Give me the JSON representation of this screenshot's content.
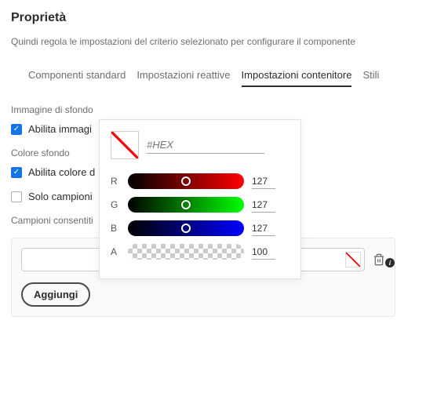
{
  "header": {
    "title": "Proprietà",
    "subtitle": "Quindi regola le impostazioni del criterio selezionato per configurare il componente"
  },
  "tabs": {
    "items": [
      {
        "label": "Componenti standard"
      },
      {
        "label": "Impostazioni reattive"
      },
      {
        "label": "Impostazioni contenitore"
      },
      {
        "label": "Stili"
      }
    ],
    "activeIndex": 2
  },
  "bgImage": {
    "sectionLabel": "Immagine di sfondo",
    "enableLabel": "Abilita immagi"
  },
  "bgColor": {
    "sectionLabel": "Colore sfondo",
    "enableLabel": "Abilita colore d",
    "swatchOnlyLabel": "Solo campioni"
  },
  "colorPicker": {
    "hexPlaceholder": "#HEX",
    "channels": {
      "r": {
        "label": "R",
        "value": "127"
      },
      "g": {
        "label": "G",
        "value": "127"
      },
      "b": {
        "label": "B",
        "value": "127"
      },
      "a": {
        "label": "A",
        "value": "100"
      }
    }
  },
  "swatches": {
    "sectionLabel": "Campioni consentiti",
    "addLabel": "Aggiungi"
  }
}
